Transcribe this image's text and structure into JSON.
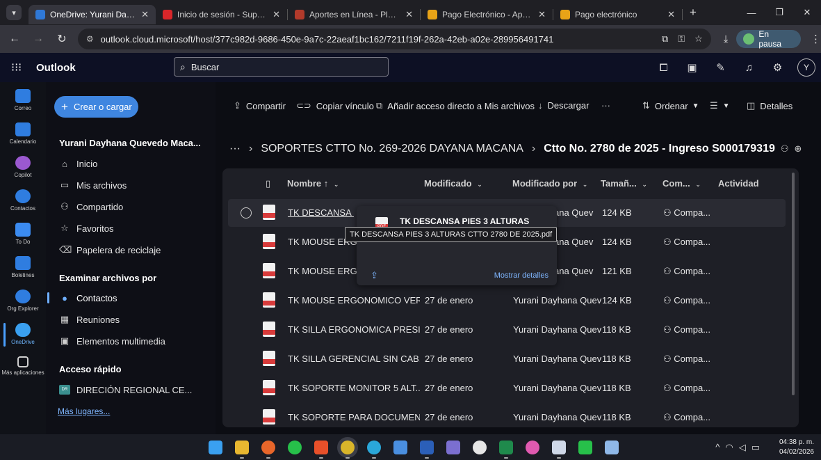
{
  "browser": {
    "tabs": [
      {
        "title": "OneDrive: Yurani Dayhana Quevedo Macana",
        "active": true,
        "color": "#2f78d6"
      },
      {
        "title": "Inicio de sesión - Superintendencia",
        "active": false,
        "color": "#d9262a"
      },
      {
        "title": "Aportes en Línea - Planilla de pago",
        "active": false,
        "color": "#b23a2b"
      },
      {
        "title": "Pago Electrónico - Aportes en Línea",
        "active": false,
        "color": "#e8a317"
      },
      {
        "title": "Pago electrónico",
        "active": false,
        "color": "#e8a317"
      }
    ],
    "close_glyph": "✕",
    "new_tab_glyph": "+",
    "url": "outlook.cloud.microsoft/host/377c982d-9686-450e-9a7c-22aeaf1bc162/7211f19f-262a-42eb-a02e-289956491741",
    "profile_status": "En pausa"
  },
  "outlook": {
    "app_title": "Outlook",
    "search_placeholder": "Buscar",
    "avatar_initial": "Y"
  },
  "rail": [
    {
      "label": "Correo",
      "color": "#2f7de0"
    },
    {
      "label": "Calendario",
      "color": "#2f7de0"
    },
    {
      "label": "Copilot",
      "color": "#9b59d0"
    },
    {
      "label": "Contactos",
      "color": "#2f7de0"
    },
    {
      "label": "To Do",
      "color": "#3b8bf0"
    },
    {
      "label": "Boletines",
      "color": "#2f7de0"
    },
    {
      "label": "Org Explorer",
      "color": "#2f7de0"
    },
    {
      "label": "OneDrive",
      "color": "#3aa0f0"
    },
    {
      "label": "Más aplicaciones",
      "color": "#cfcfcf"
    }
  ],
  "leftnav": {
    "create_label": "Crear o cargar",
    "user_name": "Yurani Dayhana Quevedo Maca...",
    "items": [
      {
        "label": "Inicio",
        "icon": "home-icon"
      },
      {
        "label": "Mis archivos",
        "icon": "folder-icon"
      },
      {
        "label": "Compartido",
        "icon": "people-icon"
      },
      {
        "label": "Favoritos",
        "icon": "star-icon"
      },
      {
        "label": "Papelera de reciclaje",
        "icon": "trash-icon"
      }
    ],
    "browse_header": "Examinar archivos por",
    "browse_items": [
      {
        "label": "Contactos",
        "icon": "person-icon"
      },
      {
        "label": "Reuniones",
        "icon": "calendar-icon"
      },
      {
        "label": "Elementos multimedia",
        "icon": "image-icon"
      }
    ],
    "quick_header": "Acceso rápido",
    "quick_items": [
      {
        "label": "DIRECIÓN REGIONAL CE...",
        "chip": "DR"
      }
    ],
    "more_places": "Más lugares..."
  },
  "toolbar": {
    "share": "Compartir",
    "copy_link": "Copiar vínculo",
    "add_shortcut": "Añadir acceso directo a Mis archivos",
    "download": "Descargar",
    "more": "···",
    "sort": "Ordenar",
    "details": "Detalles"
  },
  "breadcrumb": {
    "ellipsis": "···",
    "parent": "SOPORTES CTTO No. 269-2026 DAYANA MACANA",
    "current": "Ctto No. 2780 de 2025 - Ingreso S000179319"
  },
  "columns": {
    "name": "Nombre ↑",
    "modified": "Modificado",
    "modified_by": "Modificado por",
    "size": "Tamañ...",
    "sharing": "Com...",
    "activity": "Actividad"
  },
  "files": [
    {
      "name": "TK DESCANSA ...",
      "modified": "",
      "modified_by": "ana Quev",
      "size": "124 KB",
      "sharing": "Compa..."
    },
    {
      "name": "TK MOUSE ERGONOM",
      "modified": "",
      "modified_by": "ana Quev",
      "size": "124 KB",
      "sharing": "Compa..."
    },
    {
      "name": "TK MOUSE ERGONO",
      "modified": "",
      "modified_by": "ana Quev",
      "size": "121 KB",
      "sharing": "Compa..."
    },
    {
      "name": "TK MOUSE ERGONOMICO VER...",
      "modified": "27 de enero",
      "modified_by": "Yurani Dayhana Quev",
      "size": "124 KB",
      "sharing": "Compa..."
    },
    {
      "name": "TK SILLA ERGONOMICA PRESI...",
      "modified": "27 de enero",
      "modified_by": "Yurani Dayhana Quev",
      "size": "118 KB",
      "sharing": "Compa..."
    },
    {
      "name": "TK SILLA GERENCIAL SIN CAB...",
      "modified": "27 de enero",
      "modified_by": "Yurani Dayhana Quev",
      "size": "118 KB",
      "sharing": "Compa..."
    },
    {
      "name": "TK SOPORTE MONITOR 5 ALT...",
      "modified": "27 de enero",
      "modified_by": "Yurani Dayhana Quev",
      "size": "118 KB",
      "sharing": "Compa..."
    },
    {
      "name": "TK SOPORTE PARA DOCUMEN...",
      "modified": "27 de enero",
      "modified_by": "Yurani Dayhana Quev",
      "size": "118 KB",
      "sharing": "Compa..."
    }
  ],
  "hovercard": {
    "badge": "PDF",
    "title": "TK DESCANSA PIES 3 ALTURAS",
    "tooltip": "TK DESCANSA PIES 3 ALTURAS CTTO 2780 DE 2025.pdf",
    "details_link": "Mostrar detalles"
  },
  "taskbar": {
    "icons": [
      {
        "name": "windows-start-icon",
        "color": "#3aa0f0"
      },
      {
        "name": "file-explorer-icon",
        "color": "#e8b730"
      },
      {
        "name": "firefox-icon",
        "color": "#e8662a"
      },
      {
        "name": "whatsapp-icon",
        "color": "#27c04a"
      },
      {
        "name": "brave-icon",
        "color": "#e8502a"
      },
      {
        "name": "chrome-icon",
        "color": "#d9b52a"
      },
      {
        "name": "edge-icon",
        "color": "#2aa7d9"
      },
      {
        "name": "store-icon",
        "color": "#4a8fe0"
      },
      {
        "name": "word-icon",
        "color": "#2b5fb8"
      },
      {
        "name": "notepad-icon",
        "color": "#7b6fd0"
      },
      {
        "name": "whatsapp-alt-icon",
        "color": "#e6e6e6"
      },
      {
        "name": "excel-icon",
        "color": "#1f8a4c"
      },
      {
        "name": "copilot-app-icon",
        "color": "#e05ab0"
      },
      {
        "name": "document-viewer-icon",
        "color": "#cfd8e8"
      },
      {
        "name": "finance-icon",
        "color": "#27c04a"
      },
      {
        "name": "notes-icon",
        "color": "#8fb8e8"
      }
    ],
    "time": "04:38 p. m.",
    "date": "04/02/2026"
  }
}
